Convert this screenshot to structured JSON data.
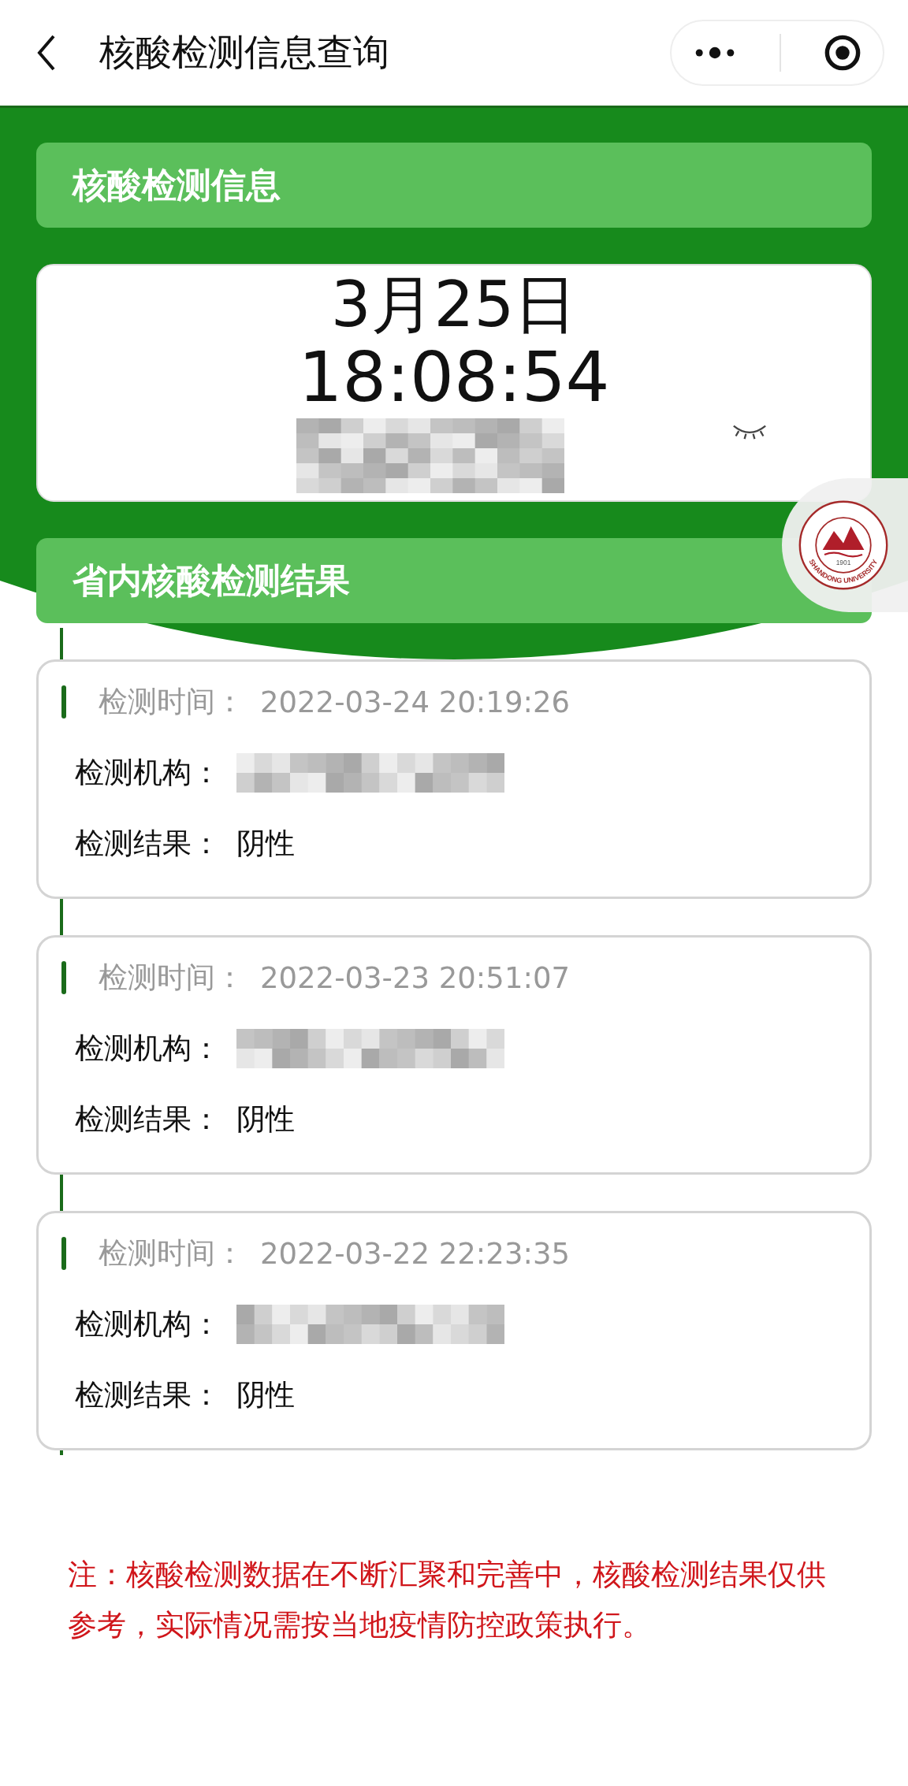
{
  "nav_bar": {
    "title": "核酸检测信息查询"
  },
  "info_section": {
    "title": "核酸检测信息",
    "date": "3月25日",
    "time": "18:08:54"
  },
  "results_section": {
    "title": "省内核酸检测结果",
    "results": [
      {
        "time_label": "检测时间：",
        "time_value": "2022-03-24 20:19:26",
        "org_label": "检测机构：",
        "result_label": "检测结果：",
        "result_value": "阴性"
      },
      {
        "time_label": "检测时间：",
        "time_value": "2022-03-23 20:51:07",
        "org_label": "检测机构：",
        "result_label": "检测结果：",
        "result_value": "阴性"
      },
      {
        "time_label": "检测时间：",
        "time_value": "2022-03-22 22:23:35",
        "org_label": "检测机构：",
        "result_label": "检测结果：",
        "result_value": "阴性"
      }
    ]
  },
  "note": "注：核酸检测数据在不断汇聚和完善中，核酸检测结果仅供参考，实际情况需按当地疫情防控政策执行。",
  "badge": {
    "year": "1901",
    "name": "SHANDONG UNIVERSITY"
  }
}
